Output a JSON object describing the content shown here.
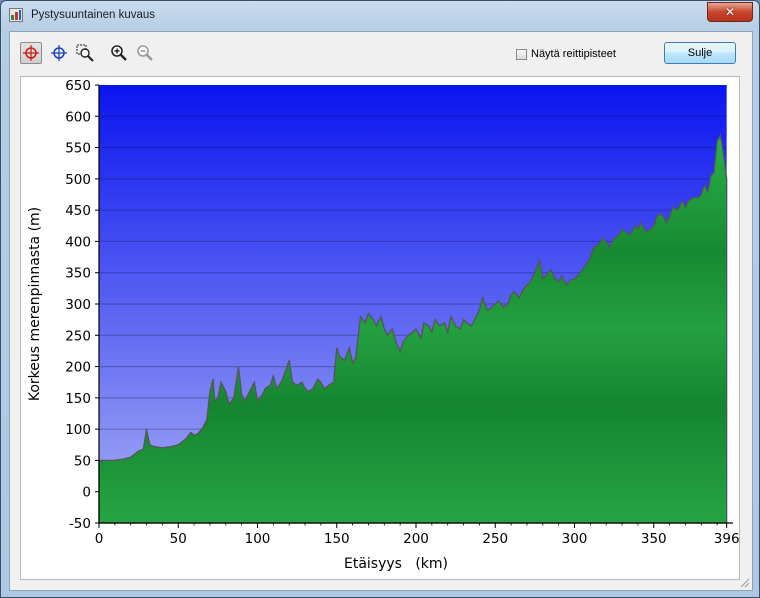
{
  "window": {
    "title": "Pystysuuntainen kuvaus",
    "close_symbol": "✕"
  },
  "toolbar": {
    "tools": [
      {
        "name": "crosshair-red-tool",
        "icon": "crosshair-red-icon",
        "active": true
      },
      {
        "name": "crosshair-blue-tool",
        "icon": "crosshair-blue-icon",
        "active": false
      },
      {
        "name": "zoom-area-tool",
        "icon": "zoom-area-icon",
        "active": false
      },
      {
        "name": "zoom-in-tool",
        "icon": "zoom-in-icon",
        "active": false
      },
      {
        "name": "zoom-out-tool",
        "icon": "zoom-out-icon",
        "active": false,
        "disabled": true
      }
    ],
    "show_waypoints_label": "Näytä reittipisteet",
    "show_waypoints_checked": false,
    "close_label": "Sulje"
  },
  "chart_data": {
    "type": "area",
    "xlabel": "Etäisyys   (km)",
    "ylabel": "Korkeus merenpinnasta (m)",
    "xlim": [
      0,
      400
    ],
    "ylim": [
      -50,
      650
    ],
    "x_ticks": [
      "0",
      "50",
      "100",
      "150",
      "200",
      "250",
      "300",
      "350",
      "396"
    ],
    "x_tick_values": [
      0,
      50,
      100,
      150,
      200,
      250,
      300,
      350,
      396
    ],
    "y_ticks": [
      "650",
      "600",
      "550",
      "500",
      "450",
      "400",
      "350",
      "300",
      "250",
      "200",
      "150",
      "100",
      "50",
      "0",
      "-50"
    ],
    "y_tick_values": [
      650,
      600,
      550,
      500,
      450,
      400,
      350,
      300,
      250,
      200,
      150,
      100,
      50,
      0,
      -50
    ],
    "grid": true,
    "colors": {
      "sky_top": "#0a14f0",
      "sky_bottom": "#9ea6f2",
      "terrain": "#1f9a3a",
      "terrain_dark": "#137a2a",
      "outline": "#555555"
    },
    "x": [
      0,
      2,
      5,
      10,
      15,
      20,
      25,
      28,
      30,
      32,
      35,
      40,
      45,
      50,
      55,
      58,
      60,
      62,
      65,
      68,
      70,
      72,
      73,
      75,
      77,
      80,
      82,
      85,
      88,
      90,
      92,
      95,
      98,
      100,
      103,
      105,
      108,
      110,
      112,
      115,
      118,
      120,
      122,
      125,
      128,
      130,
      132,
      135,
      138,
      140,
      142,
      145,
      148,
      150,
      152,
      155,
      158,
      160,
      162,
      165,
      168,
      170,
      173,
      175,
      178,
      180,
      182,
      185,
      188,
      190,
      192,
      195,
      198,
      200,
      203,
      205,
      208,
      210,
      212,
      215,
      218,
      220,
      222,
      225,
      228,
      230,
      232,
      235,
      238,
      240,
      242,
      245,
      248,
      250,
      252,
      255,
      258,
      260,
      262,
      265,
      268,
      270,
      272,
      275,
      278,
      280,
      282,
      285,
      288,
      290,
      292,
      295,
      298,
      300,
      302,
      305,
      308,
      310,
      312,
      315,
      318,
      320,
      322,
      325,
      328,
      330,
      332,
      335,
      338,
      340,
      342,
      345,
      348,
      350,
      352,
      355,
      358,
      360,
      362,
      365,
      368,
      370,
      372,
      375,
      378,
      380,
      382,
      384,
      385,
      386,
      388,
      390,
      392,
      394,
      396
    ],
    "y": [
      48,
      50,
      50,
      50,
      52,
      55,
      65,
      68,
      100,
      75,
      72,
      70,
      72,
      75,
      85,
      95,
      90,
      92,
      100,
      115,
      160,
      180,
      145,
      150,
      175,
      160,
      140,
      150,
      200,
      155,
      145,
      160,
      175,
      145,
      155,
      165,
      170,
      185,
      165,
      175,
      195,
      210,
      175,
      170,
      175,
      165,
      160,
      165,
      180,
      175,
      165,
      170,
      175,
      230,
      215,
      210,
      230,
      205,
      215,
      280,
      270,
      285,
      275,
      265,
      280,
      260,
      250,
      260,
      235,
      225,
      240,
      250,
      255,
      260,
      245,
      270,
      265,
      255,
      275,
      265,
      270,
      255,
      280,
      265,
      260,
      275,
      270,
      265,
      280,
      290,
      310,
      290,
      295,
      300,
      305,
      295,
      300,
      315,
      320,
      310,
      325,
      330,
      335,
      350,
      370,
      340,
      345,
      355,
      340,
      335,
      345,
      330,
      340,
      340,
      345,
      355,
      365,
      375,
      390,
      395,
      405,
      400,
      390,
      405,
      410,
      420,
      415,
      410,
      425,
      420,
      430,
      415,
      420,
      425,
      440,
      445,
      430,
      440,
      455,
      450,
      465,
      455,
      465,
      470,
      470,
      475,
      490,
      480,
      490,
      505,
      510,
      560,
      570,
      540,
      500,
      495,
      500,
      505,
      495
    ]
  }
}
